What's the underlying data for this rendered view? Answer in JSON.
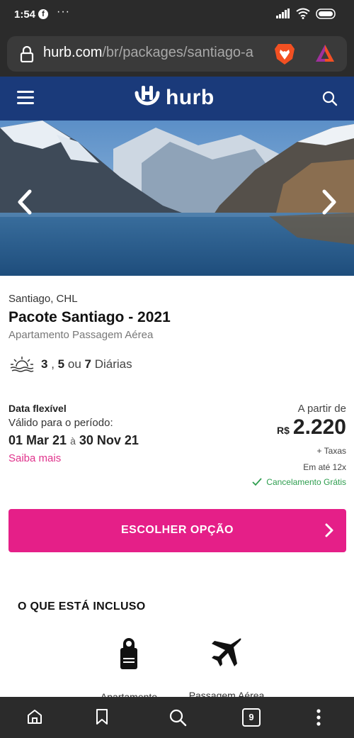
{
  "status_bar": {
    "time": "1:54",
    "dots": "···"
  },
  "browser": {
    "url_host": "hurb.com",
    "url_path": "/br/packages/santiago-a",
    "tab_count": "9"
  },
  "site": {
    "logo_text": "hurb"
  },
  "product": {
    "location": "Santiago, CHL",
    "title": "Pacote Santiago - 2021",
    "subtitle": "Apartamento Passagem Aérea",
    "nights": {
      "n1": "3",
      "sep1": ",",
      "n2": "5",
      "sep2": "ou",
      "n3": "7",
      "label": "Diárias"
    },
    "flexible_label": "Data flexível",
    "valid_label": "Válido para o período:",
    "date_start": "01 Mar 21",
    "date_sep": "à",
    "date_end": "30 Nov 21",
    "learn_more": "Saiba mais"
  },
  "pricing": {
    "from_label": "A partir de",
    "currency": "R$",
    "value": "2.220",
    "taxes": "+ Taxas",
    "installments": "Em até 12x",
    "cancellation": "Cancelamento Grátis"
  },
  "cta": {
    "label": "ESCOLHER OPÇÃO"
  },
  "included": {
    "title": "O QUE ESTÁ INCLUSO",
    "items": [
      {
        "label": "Apartamento",
        "icon": "door-hanger-icon"
      },
      {
        "label": "Passagem Aérea",
        "icon": "airplane-icon"
      }
    ]
  },
  "colors": {
    "header": "#1a3a7a",
    "accent": "#e51f88",
    "success": "#2e9e4f",
    "browser_chrome": "#2b2b2b"
  }
}
